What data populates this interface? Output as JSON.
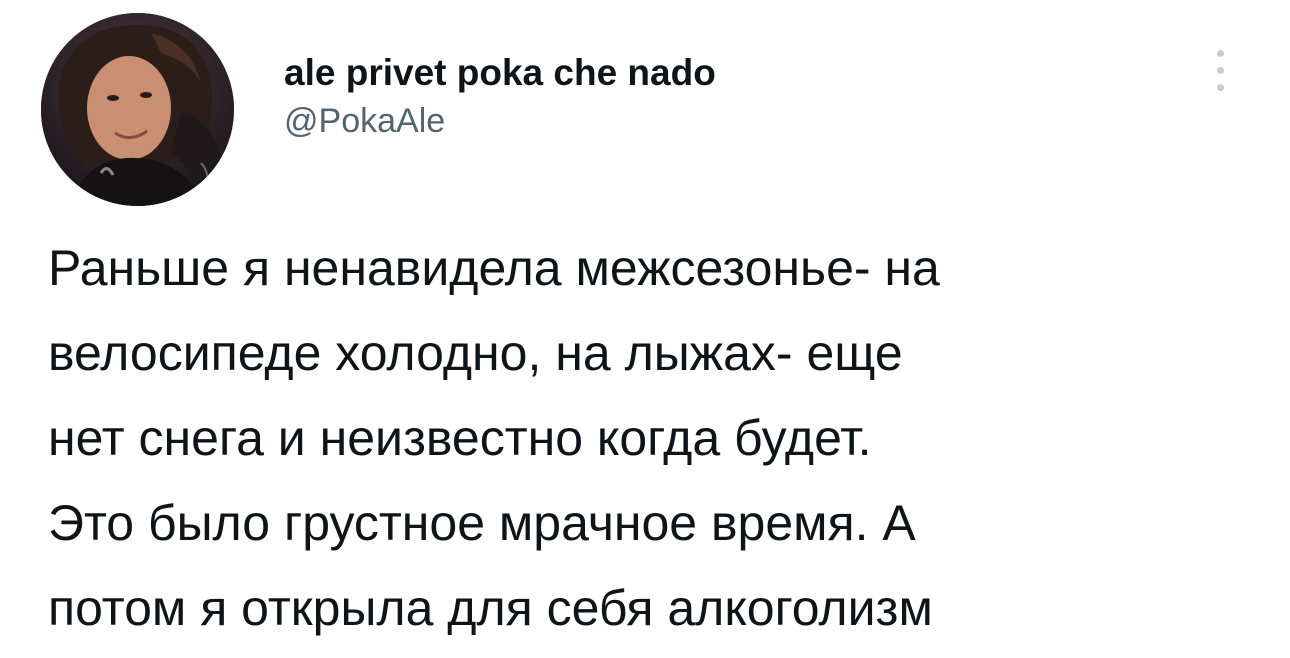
{
  "tweet": {
    "author": {
      "display_name": "ale privet poka che nado",
      "handle": "@PokaAle",
      "avatar_icon": "avatar-photo"
    },
    "more_icon": "more-vertical-icon",
    "text_lines": [
      "Раньше я ненавидела межсезонье- на",
      "велосипеде холодно, на лыжах- еще",
      "нет снега и неизвестно когда будет.",
      "Это было грустное мрачное время. А",
      "потом я открыла для себя алкоголизм"
    ]
  },
  "colors": {
    "text_primary": "#0f1419",
    "text_secondary": "#536471",
    "more_dots": "#c6ccd2",
    "background": "#ffffff"
  }
}
